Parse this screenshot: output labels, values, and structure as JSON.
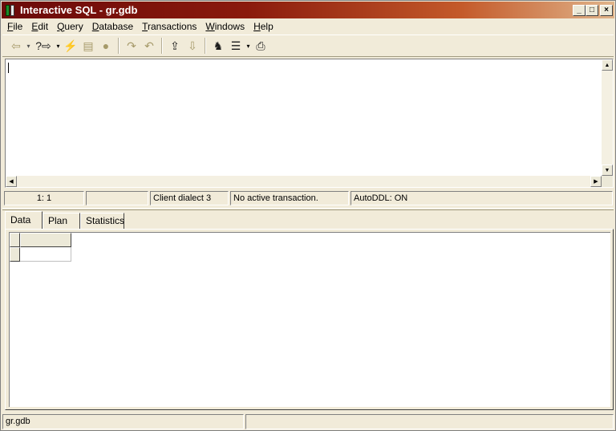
{
  "window": {
    "title": "Interactive SQL - gr.gdb",
    "minimize": "_",
    "maximize": "□",
    "close": "×"
  },
  "menu": {
    "items": [
      {
        "label": "File",
        "ul": "F",
        "rest": "ile"
      },
      {
        "label": "Edit",
        "ul": "E",
        "rest": "dit"
      },
      {
        "label": "Query",
        "ul": "Q",
        "rest": "uery"
      },
      {
        "label": "Database",
        "ul": "D",
        "rest": "atabase"
      },
      {
        "label": "Transactions",
        "ul": "T",
        "rest": "ransactions"
      },
      {
        "label": "Windows",
        "ul": "W",
        "rest": "indows"
      },
      {
        "label": "Help",
        "ul": "H",
        "rest": "elp"
      }
    ]
  },
  "toolbar": {
    "previous_query_icon": "⇦",
    "next_query_icon": "?⇨",
    "execute_icon": "⚡",
    "prepare_icon": "▤",
    "save_icon": "●",
    "redo_icon": "↷",
    "undo_icon": "↶",
    "commit_icon": "⇪",
    "rollback_icon": "⇩",
    "find_icon": "♞",
    "windows_icon": "☰",
    "print_icon": "⎙",
    "dropdown": "▾"
  },
  "editor": {
    "text": ""
  },
  "editor_status": {
    "position": "1:  1",
    "empty": "",
    "dialect": "Client dialect 3",
    "transaction": "No active transaction.",
    "autoddl": "AutoDDL: ON"
  },
  "tabs": {
    "data": "Data",
    "plan": "Plan",
    "statistics": "Statistics"
  },
  "statusbar": {
    "database": "gr.gdb",
    "message": ""
  },
  "colors": {
    "title_gradient_start": "#6b0a0a",
    "title_gradient_end": "#e0b48a",
    "window_bg": "#f1ebd9"
  }
}
